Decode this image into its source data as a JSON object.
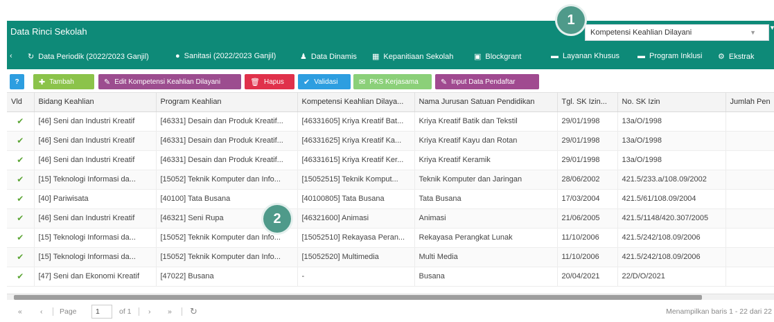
{
  "window": {
    "title": "Data Rinci Sekolah"
  },
  "selector": {
    "value": "Kompetensi Keahlian Dilayani"
  },
  "tabs": [
    {
      "label": "Data Periodik (2022/2023 Ganjil)",
      "icon": "history-icon"
    },
    {
      "label": "Sanitasi (2022/2023 Ganjil)",
      "icon": "water-drop-icon"
    },
    {
      "label": "Data Dinamis",
      "icon": "people-icon"
    },
    {
      "label": "Kepanitiaan Sekolah",
      "icon": "institution-icon"
    },
    {
      "label": "Blockgrant",
      "icon": "money-icon"
    },
    {
      "label": "Layanan Khusus",
      "icon": "list-icon"
    },
    {
      "label": "Program Inklusi",
      "icon": "list-icon"
    },
    {
      "label": "Ekstrak",
      "icon": "gear-icon"
    }
  ],
  "toolbar": {
    "help": "?",
    "add": "Tambah",
    "edit": "Edit Kompetensi Keahlian Dilayani",
    "delete": "Hapus",
    "validate": "Validasi",
    "pks": "PKS Kerjasama",
    "input": "Input Data Pendaftar"
  },
  "columns": [
    "Vld",
    "Bidang Keahlian",
    "Program Keahlian",
    "Kompetensi Keahlian Dilaya...",
    "Nama Jurusan Satuan Pendidikan",
    "Tgl. SK Izin...",
    "No. SK Izin",
    "Jumlah Pen"
  ],
  "rows": [
    {
      "vld": "✔",
      "bidang": "[46] Seni dan Industri Kreatif",
      "program": "[46331] Desain dan Produk Kreatif...",
      "kompetensi": "[46331605] Kriya Kreatif Bat...",
      "nama": "Kriya Kreatif Batik dan Tekstil",
      "tgl": "29/01/1998",
      "no": "13a/O/1998"
    },
    {
      "vld": "✔",
      "bidang": "[46] Seni dan Industri Kreatif",
      "program": "[46331] Desain dan Produk Kreatif...",
      "kompetensi": "[46331625] Kriya Kreatif Ka...",
      "nama": "Kriya Kreatif Kayu dan Rotan",
      "tgl": "29/01/1998",
      "no": "13a/O/1998"
    },
    {
      "vld": "✔",
      "bidang": "[46] Seni dan Industri Kreatif",
      "program": "[46331] Desain dan Produk Kreatif...",
      "kompetensi": "[46331615] Kriya Kreatif Ker...",
      "nama": "Kriya Kreatif Keramik",
      "tgl": "29/01/1998",
      "no": "13a/O/1998"
    },
    {
      "vld": "✔",
      "bidang": "[15] Teknologi Informasi da...",
      "program": "[15052] Teknik Komputer dan Info...",
      "kompetensi": "[15052515] Teknik Komput...",
      "nama": "Teknik Komputer dan Jaringan",
      "tgl": "28/06/2002",
      "no": "421.5/233.a/108.09/2002"
    },
    {
      "vld": "✔",
      "bidang": "[40] Pariwisata",
      "program": "[40100] Tata Busana",
      "kompetensi": "[40100805] Tata Busana",
      "nama": "Tata Busana",
      "tgl": "17/03/2004",
      "no": "421.5/61/108.09/2004"
    },
    {
      "vld": "✔",
      "bidang": "[46] Seni dan Industri Kreatif",
      "program": "[46321] Seni Rupa",
      "kompetensi": "[46321600] Animasi",
      "nama": "Animasi",
      "tgl": "21/06/2005",
      "no": "421.5/1148/420.307/2005"
    },
    {
      "vld": "✔",
      "bidang": "[15] Teknologi Informasi da...",
      "program": "[15052] Teknik Komputer dan Info...",
      "kompetensi": "[15052510] Rekayasa Peran...",
      "nama": "Rekayasa Perangkat Lunak",
      "tgl": "11/10/2006",
      "no": "421.5/242/108.09/2006"
    },
    {
      "vld": "✔",
      "bidang": "[15] Teknologi Informasi da...",
      "program": "[15052] Teknik Komputer dan Info...",
      "kompetensi": "[15052520] Multimedia",
      "nama": "Multi Media",
      "tgl": "11/10/2006",
      "no": "421.5/242/108.09/2006"
    },
    {
      "vld": "✔",
      "bidang": "[47] Seni dan Ekonomi Kreatif",
      "program": "[47022] Busana",
      "kompetensi": "-",
      "nama": "Busana",
      "tgl": "20/04/2021",
      "no": "22/D/O/2021"
    }
  ],
  "pager": {
    "page_label": "Page",
    "page_value": "1",
    "of_label": "of 1",
    "summary": "Menampilkan baris 1 - 22 dari 22"
  },
  "markers": {
    "one": "1",
    "two": "2"
  },
  "colors": {
    "header": "#0e8a78",
    "add": "#8bc34a",
    "edit": "#9c4d8f",
    "delete": "#e0314b",
    "validate": "#2d9ee0",
    "pks": "#8bd079",
    "input": "#a04a90",
    "help": "#2d9ee0",
    "marker": "#4f9a8a"
  }
}
